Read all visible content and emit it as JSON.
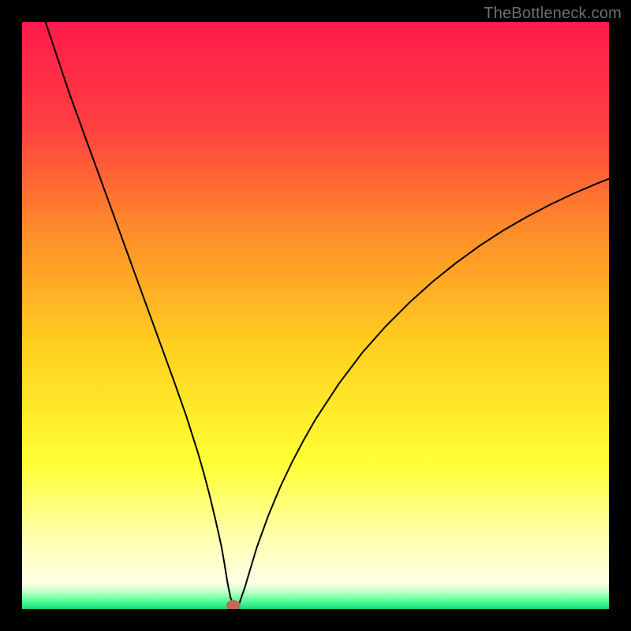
{
  "watermark": "TheBottleneck.com",
  "chart_data": {
    "type": "line",
    "title": "",
    "xlabel": "",
    "ylabel": "",
    "xlim": [
      0,
      100
    ],
    "ylim": [
      0,
      100
    ],
    "grid": false,
    "legend": false,
    "background_gradient": {
      "stops": [
        {
          "offset": 0.0,
          "color": "#ff1a4b"
        },
        {
          "offset": 0.18,
          "color": "#ff4040"
        },
        {
          "offset": 0.35,
          "color": "#ff8a2a"
        },
        {
          "offset": 0.55,
          "color": "#ffcf1f"
        },
        {
          "offset": 0.75,
          "color": "#ffff33"
        },
        {
          "offset": 0.88,
          "color": "#ffffb0"
        },
        {
          "offset": 0.955,
          "color": "#ffffe6"
        },
        {
          "offset": 0.97,
          "color": "#c8ffca"
        },
        {
          "offset": 0.985,
          "color": "#5dff9a"
        },
        {
          "offset": 1.0,
          "color": "#12e07d"
        }
      ]
    },
    "series": [
      {
        "name": "bottleneck-curve",
        "stroke": "#000000",
        "stroke_width": 2,
        "x": [
          4,
          6,
          8,
          10,
          12,
          14,
          16,
          18,
          20,
          22,
          24,
          26,
          28,
          30,
          31,
          32,
          33,
          34,
          34.5,
          35,
          35.5,
          36,
          36.5,
          37,
          38,
          40,
          42,
          44,
          46,
          48,
          50,
          54,
          58,
          62,
          66,
          70,
          74,
          78,
          82,
          86,
          90,
          94,
          98,
          100
        ],
        "y": [
          100,
          94,
          88,
          82.5,
          77,
          71.5,
          66,
          60.5,
          55,
          49.5,
          44,
          38.5,
          32.8,
          26.5,
          23,
          19.2,
          15,
          10.5,
          7.6,
          4.5,
          2.0,
          0.7,
          0.2,
          0.9,
          3.8,
          10.5,
          16.0,
          20.8,
          25.0,
          28.8,
          32.3,
          38.4,
          43.7,
          48.2,
          52.2,
          55.8,
          59.0,
          61.9,
          64.5,
          66.8,
          68.9,
          70.8,
          72.5,
          73.3
        ]
      }
    ],
    "marker": {
      "x": 36,
      "y": 0.6,
      "rx": 1.2,
      "ry": 0.9,
      "fill": "#c06a5a"
    }
  }
}
